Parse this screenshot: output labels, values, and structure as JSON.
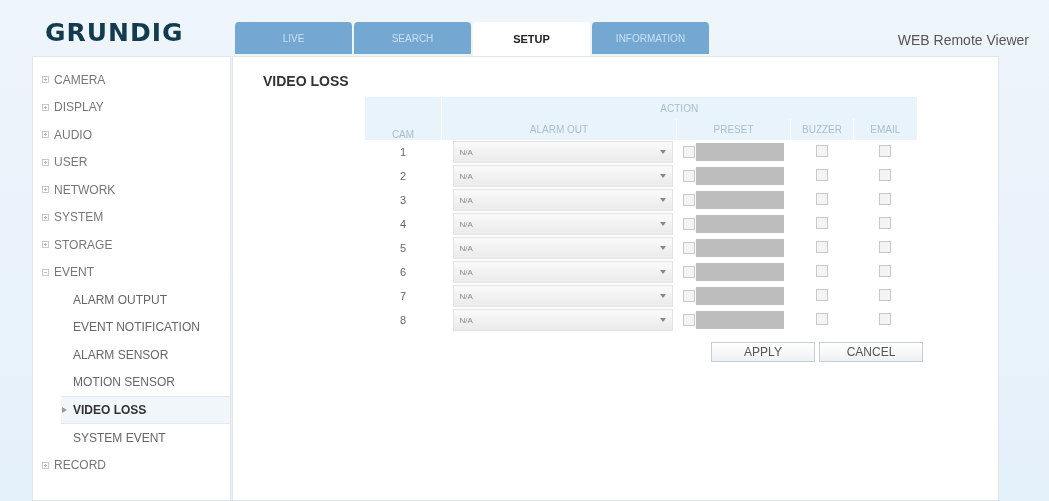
{
  "header": {
    "logo": "GRUNDIG",
    "app_title": "WEB Remote Viewer"
  },
  "tabs": [
    {
      "label": "LIVE",
      "selected": false
    },
    {
      "label": "SEARCH",
      "selected": false
    },
    {
      "label": "SETUP",
      "selected": true
    },
    {
      "label": "INFORMATION",
      "selected": false
    }
  ],
  "sidebar": {
    "items": [
      {
        "label": "CAMERA",
        "expanded": false,
        "selected": false
      },
      {
        "label": "DISPLAY",
        "expanded": false,
        "selected": false
      },
      {
        "label": "AUDIO",
        "expanded": false,
        "selected": false
      },
      {
        "label": "USER",
        "expanded": false,
        "selected": false
      },
      {
        "label": "NETWORK",
        "expanded": false,
        "selected": false
      },
      {
        "label": "SYSTEM",
        "expanded": false,
        "selected": false
      },
      {
        "label": "STORAGE",
        "expanded": false,
        "selected": false
      },
      {
        "label": "EVENT",
        "expanded": true,
        "selected": false,
        "children": [
          {
            "label": "ALARM OUTPUT",
            "selected": false
          },
          {
            "label": "EVENT NOTIFICATION",
            "selected": false
          },
          {
            "label": "ALARM SENSOR",
            "selected": false
          },
          {
            "label": "MOTION SENSOR",
            "selected": false
          },
          {
            "label": "VIDEO LOSS",
            "selected": true
          },
          {
            "label": "SYSTEM EVENT",
            "selected": false
          }
        ]
      },
      {
        "label": "RECORD",
        "expanded": false,
        "selected": false
      }
    ]
  },
  "page_title": "VIDEO LOSS",
  "table": {
    "group_header": "ACTION",
    "columns": [
      "CAM",
      "ALARM OUT",
      "PRESET",
      "BUZZER",
      "EMAIL"
    ],
    "rows": [
      {
        "cam": "1",
        "alarm_out": "N/A",
        "preset_checked": false,
        "buzzer": false,
        "email": false
      },
      {
        "cam": "2",
        "alarm_out": "N/A",
        "preset_checked": false,
        "buzzer": false,
        "email": false
      },
      {
        "cam": "3",
        "alarm_out": "N/A",
        "preset_checked": false,
        "buzzer": false,
        "email": false
      },
      {
        "cam": "4",
        "alarm_out": "N/A",
        "preset_checked": false,
        "buzzer": false,
        "email": false
      },
      {
        "cam": "5",
        "alarm_out": "N/A",
        "preset_checked": false,
        "buzzer": false,
        "email": false
      },
      {
        "cam": "6",
        "alarm_out": "N/A",
        "preset_checked": false,
        "buzzer": false,
        "email": false
      },
      {
        "cam": "7",
        "alarm_out": "N/A",
        "preset_checked": false,
        "buzzer": false,
        "email": false
      },
      {
        "cam": "8",
        "alarm_out": "N/A",
        "preset_checked": false,
        "buzzer": false,
        "email": false
      }
    ]
  },
  "buttons": [
    "APPLY",
    "CANCEL"
  ]
}
